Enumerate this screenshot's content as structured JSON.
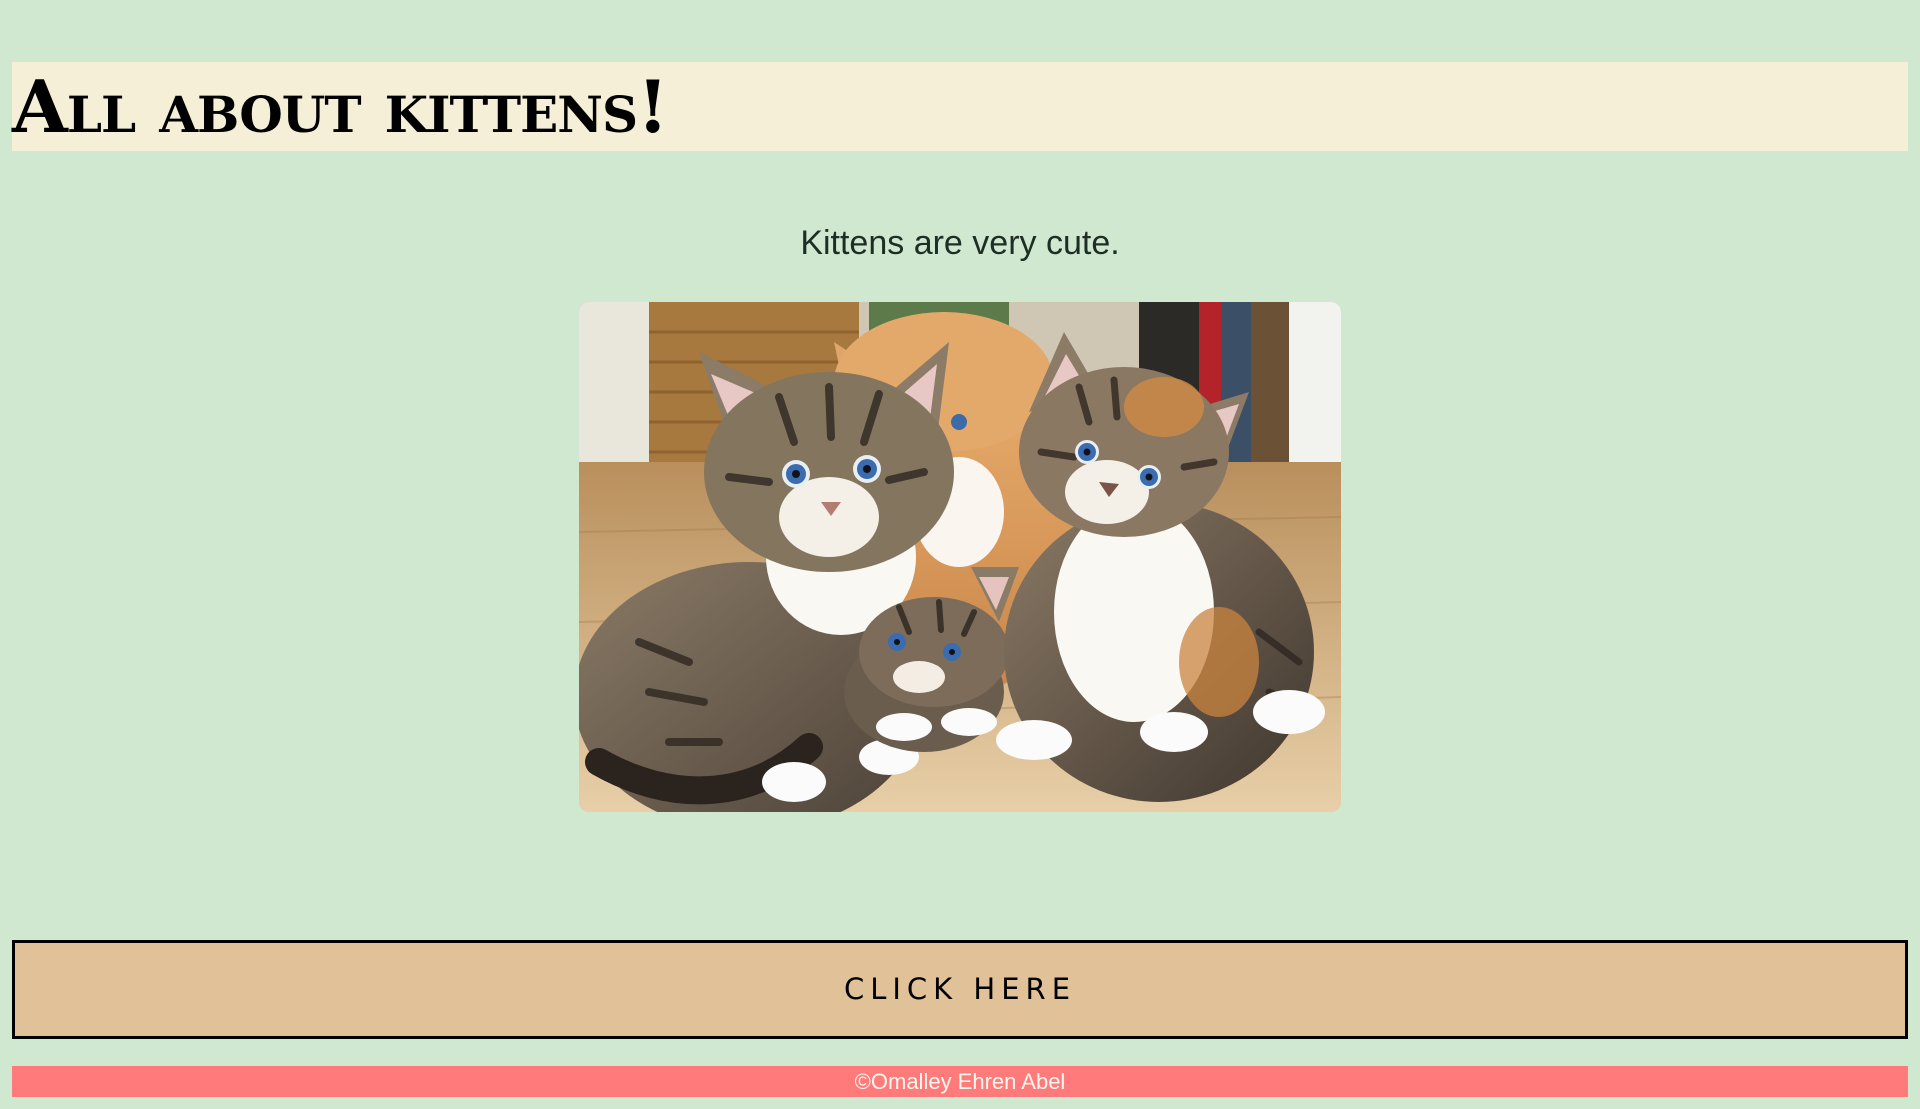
{
  "header": {
    "title": "All about kittens!"
  },
  "intro": {
    "tagline": "Kittens are very cute."
  },
  "hero_image": {
    "alt": "Four tabby kittens sitting on a wooden floor"
  },
  "cta": {
    "label": "CLICK HERE"
  },
  "footer": {
    "copyright": "©Omalley Ehren Abel"
  },
  "colors": {
    "page_background": "#d0e7d0",
    "header_background": "#f5efd7",
    "button_background": "#e0c198",
    "footer_background": "#ff7b7b"
  }
}
